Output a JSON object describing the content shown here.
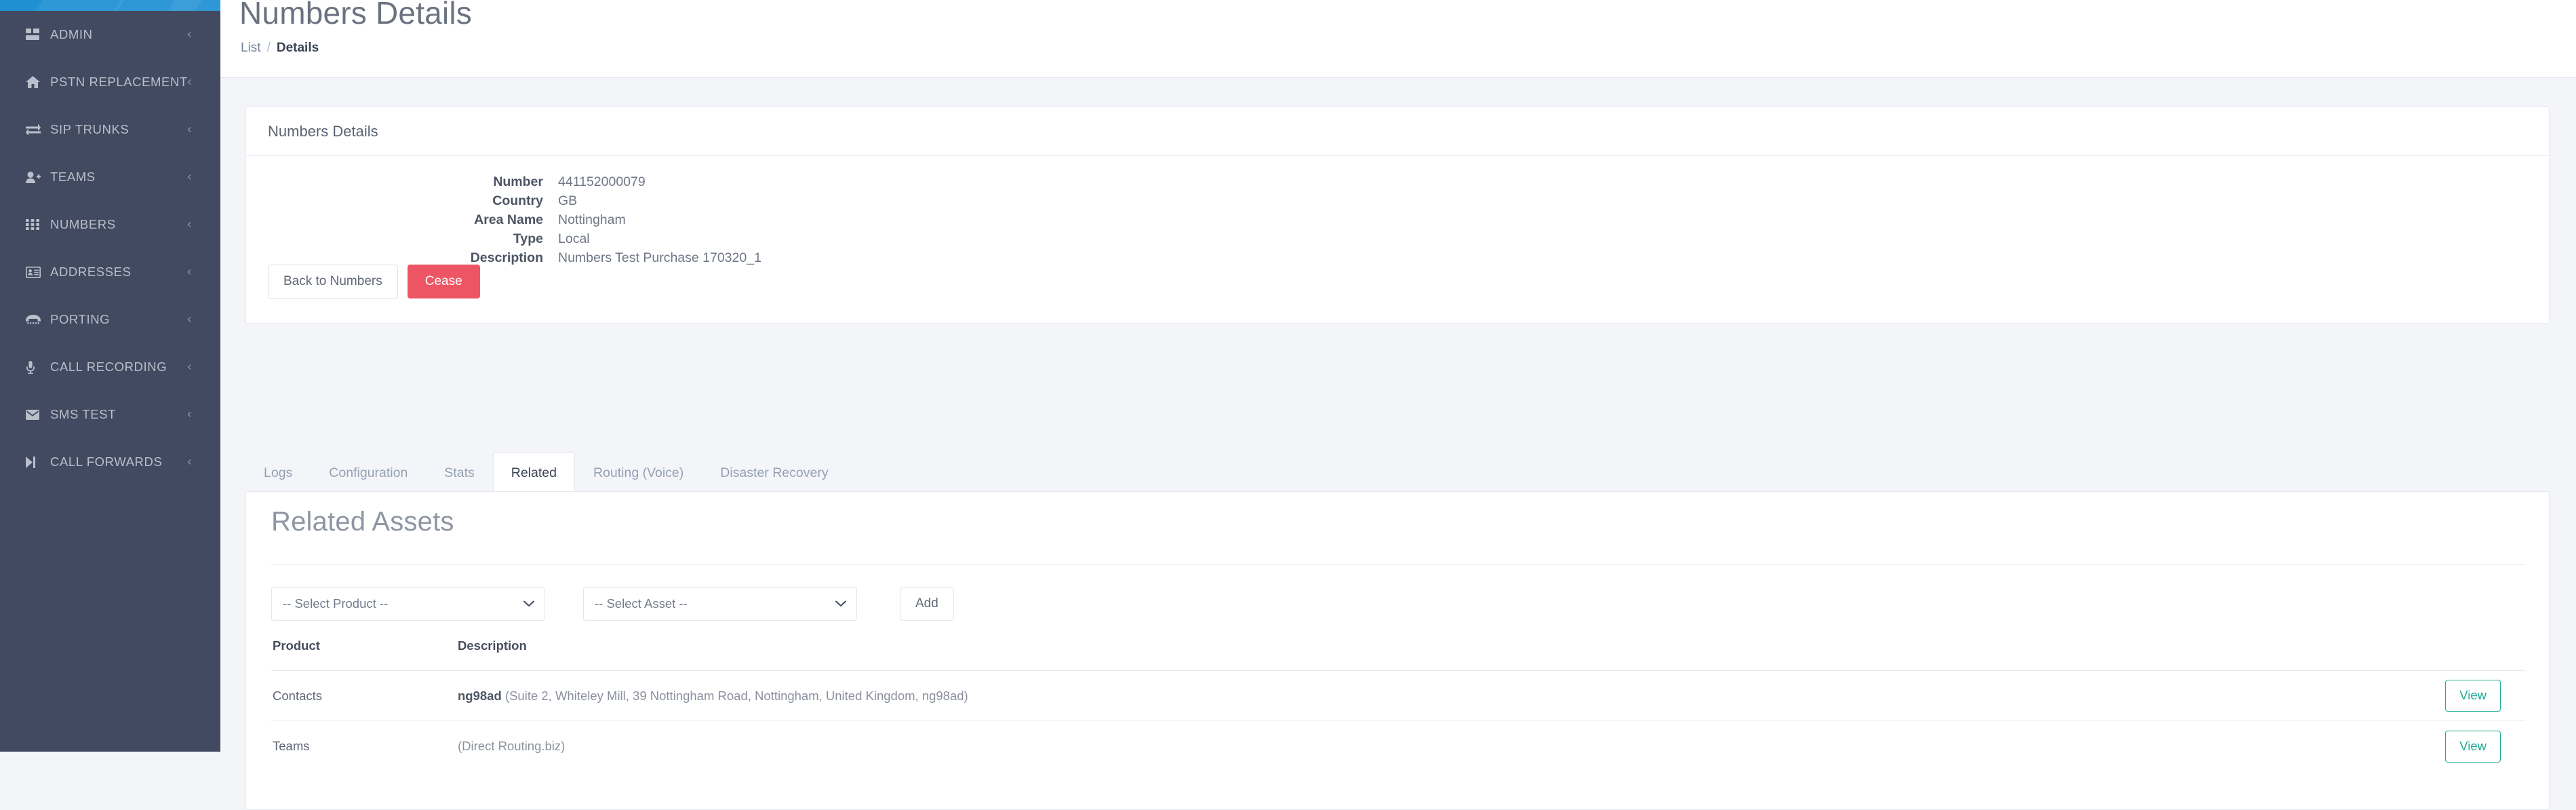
{
  "sidebar": {
    "items": [
      {
        "label": "ADMIN",
        "icon": "dashboard-icon",
        "caret": "‹"
      },
      {
        "label": "PSTN REPLACEMENT",
        "icon": "home-icon",
        "caret": "‹"
      },
      {
        "label": "SIP TRUNKS",
        "icon": "exchange-icon",
        "caret": "‹"
      },
      {
        "label": "TEAMS",
        "icon": "user-plus-icon",
        "caret": "‹"
      },
      {
        "label": "NUMBERS",
        "icon": "grid-icon",
        "caret": "‹"
      },
      {
        "label": "ADDRESSES",
        "icon": "id-card-icon",
        "caret": "‹"
      },
      {
        "label": "PORTING",
        "icon": "telephone-icon",
        "caret": "‹"
      },
      {
        "label": "CALL RECORDING",
        "icon": "microphone-icon",
        "caret": "‹"
      },
      {
        "label": "SMS TEST",
        "icon": "envelope-icon",
        "caret": "‹"
      },
      {
        "label": "CALL FORWARDS",
        "icon": "step-forward-icon",
        "caret": "‹"
      }
    ]
  },
  "header": {
    "title": "Numbers Details",
    "breadcrumb": {
      "list": "List",
      "separator": "/",
      "current": "Details"
    }
  },
  "details_card": {
    "title": "Numbers Details",
    "fields": [
      {
        "label": "Number",
        "value": "441152000079"
      },
      {
        "label": "Country",
        "value": "GB"
      },
      {
        "label": "Area Name",
        "value": "Nottingham"
      },
      {
        "label": "Type",
        "value": "Local"
      },
      {
        "label": "Description",
        "value": "Numbers Test Purchase 170320_1"
      }
    ],
    "back_button": "Back to Numbers",
    "cease_button": "Cease"
  },
  "tabs": [
    {
      "label": "Logs",
      "active": false
    },
    {
      "label": "Configuration",
      "active": false
    },
    {
      "label": "Stats",
      "active": false
    },
    {
      "label": "Related",
      "active": true
    },
    {
      "label": "Routing (Voice)",
      "active": false
    },
    {
      "label": "Disaster Recovery",
      "active": false
    }
  ],
  "related": {
    "title": "Related Assets",
    "product_select": {
      "value": "-- Select Product --",
      "chevron": "⌄"
    },
    "asset_select": {
      "value": "-- Select Asset --",
      "chevron": "⌄"
    },
    "add_button": "Add",
    "table": {
      "columns": [
        "Product",
        "Description"
      ],
      "action_label": "View",
      "rows": [
        {
          "product": "Contacts",
          "desc_bold": "ng98ad",
          "desc_rest": " (Suite 2, Whiteley Mill, 39 Nottingham Road, Nottingham, United Kingdom, ng98ad)",
          "action": "View"
        },
        {
          "product": "Teams",
          "desc_bold": "",
          "desc_rest": "(Direct Routing.biz)",
          "action": "View"
        }
      ]
    }
  },
  "colors": {
    "sidebar_bg": "#414a60",
    "topbar_blue": "#1f90d2",
    "danger": "#ed5565",
    "teal": "#1cab95",
    "page_bg": "#f4f5f9"
  }
}
